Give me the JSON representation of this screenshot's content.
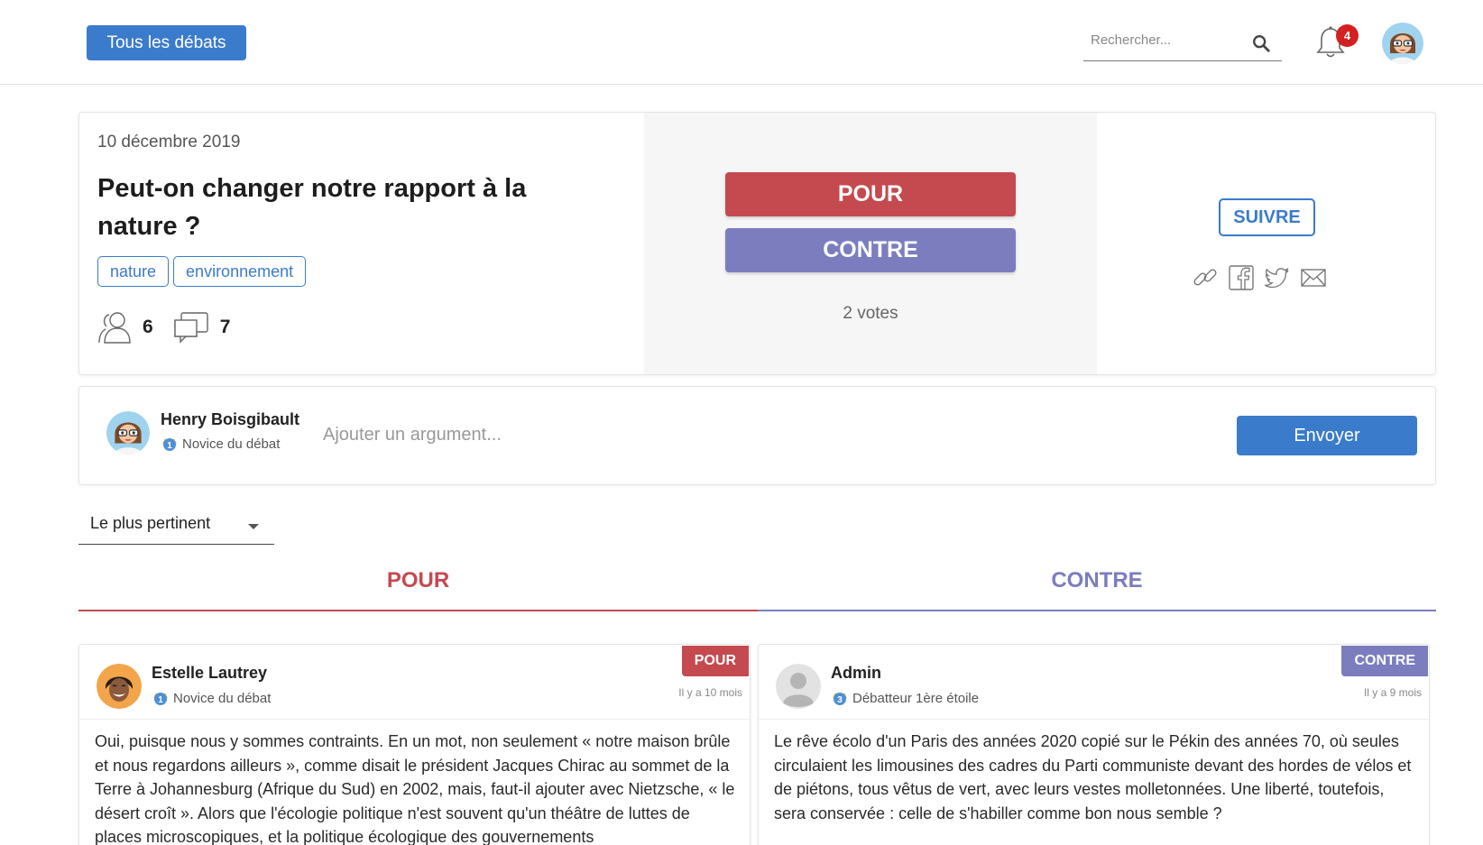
{
  "header": {
    "all_debates_label": "Tous les débats",
    "search_placeholder": "Rechercher...",
    "notifications_count": "4"
  },
  "debate": {
    "date": "10 décembre 2019",
    "title": "Peut-on changer notre rapport à la nature ?",
    "tags": [
      "nature",
      "environnement"
    ],
    "participants_count": "6",
    "comments_count": "7",
    "pour_label": "POUR",
    "contre_label": "CONTRE",
    "votes_label": "2 votes",
    "follow_label": "SUIVRE",
    "share_icons": [
      "link-icon",
      "facebook-icon",
      "twitter-icon",
      "mail-icon"
    ]
  },
  "composer": {
    "user_name": "Henry Boisgibault",
    "user_rank": "Novice du débat",
    "rank_level": "1",
    "placeholder": "Ajouter un argument...",
    "send_label": "Envoyer"
  },
  "sort": {
    "selected": "Le plus pertinent"
  },
  "tabs": {
    "pour": "POUR",
    "contre": "CONTRE"
  },
  "arguments": [
    {
      "side": "POUR",
      "author": "Estelle Lautrey",
      "rank": "Novice du débat",
      "rank_level": "1",
      "time": "Il y a 10 mois",
      "text": "Oui, puisque nous y sommes contraints. En un mot, non seulement « notre maison brûle et nous regardons ailleurs », comme disait le président Jacques Chirac au sommet de la Terre à Johannesburg (Afrique du Sud) en 2002, mais, faut-il ajouter avec Nietzsche, « le désert croît ». Alors que l'écologie politique n'est souvent qu'un théâtre de luttes de places microscopiques, et la politique écologique des gouvernements"
    },
    {
      "side": "CONTRE",
      "author": "Admin",
      "rank": "Débatteur 1ère étoile",
      "rank_level": "3",
      "time": "Il y a 9 mois",
      "text": "Le rêve écolo d'un Paris des années 2020 copié sur le Pékin des années 70, où seules circulaient les limousines des cadres du Parti communiste devant des hordes de vélos et de piétons, tous vêtus de vert, avec leurs vestes molletonnées. Une liberté, toutefois, sera conservée : celle de s'habiller comme bon nous semble ?"
    }
  ],
  "colors": {
    "accent_blue": "#3b7bcc",
    "pour_red": "#c44a4f",
    "contre_purple": "#7b7dbf",
    "badge_red": "#d32021"
  }
}
